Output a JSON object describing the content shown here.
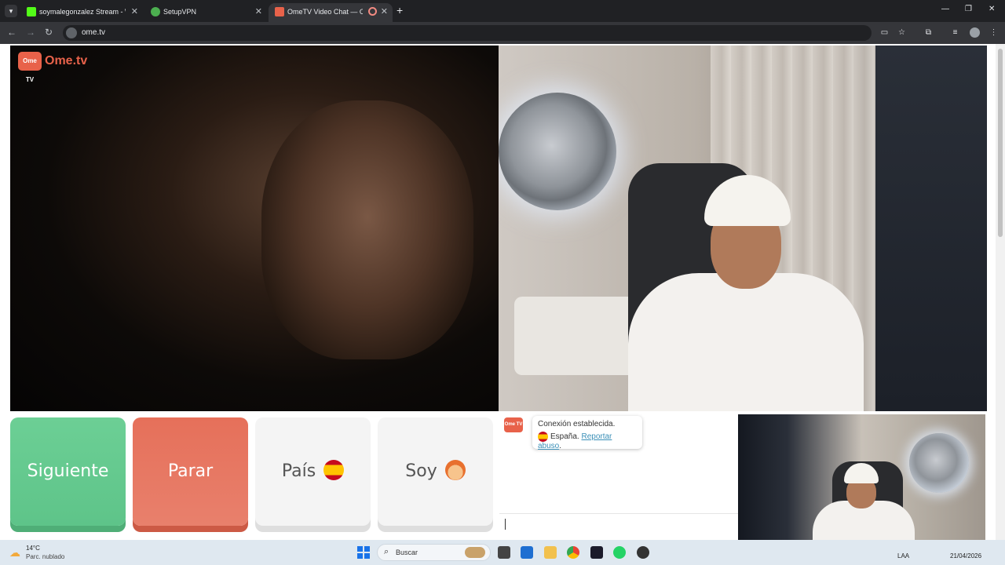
{
  "browser": {
    "tabs": [
      {
        "label": "soymalegonzalez Stream - Wat",
        "favicon": "kick-icon",
        "favicon_color": "#53fc18",
        "active": false
      },
      {
        "label": "SetupVPN",
        "favicon": "vpn-icon",
        "favicon_color": "#4caf50",
        "active": false
      },
      {
        "label": "OmeTV Video Chat — Ome",
        "favicon": "ometv-icon",
        "favicon_color": "#e8624a",
        "active": true
      }
    ],
    "url": "ome.tv"
  },
  "ometv": {
    "logo_badge": "Ome TV",
    "logo_text": "Ome.tv",
    "buttons": {
      "next": "Siguiente",
      "stop": "Parar",
      "country": "País",
      "gender": "Soy"
    },
    "chat": {
      "logo_badge": "Ome TV",
      "status": "Conexión establecida.",
      "country": "España.",
      "report_link": "Reportar abuso",
      "report_suffix": "."
    },
    "colors": {
      "next": "#6ccf95",
      "stop": "#e6705a",
      "neutral": "#f4f4f4",
      "brand": "#e8624a",
      "link": "#3a8fb7"
    }
  },
  "taskbar": {
    "temperature": "14°C",
    "condition": "Parc. nublado",
    "search_placeholder": "Buscar",
    "language": "LAA",
    "date": "21/04/2026"
  }
}
